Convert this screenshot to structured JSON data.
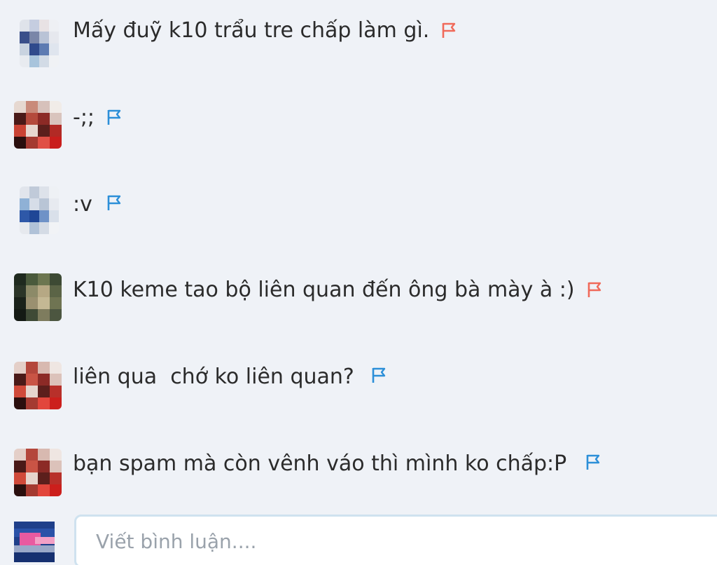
{
  "comments": [
    {
      "text": "Mấy đuỹ k10 trẩu tre chấp làm gì.",
      "flag": "red-flag-icon",
      "flag_color": "#f06a5a"
    },
    {
      "text": "-;;",
      "flag": "blue-flag-icon",
      "flag_color": "#2c8fd8"
    },
    {
      "text": ":v",
      "flag": "blue-flag-icon",
      "flag_color": "#2c8fd8"
    },
    {
      "text": "K10 keme tao bộ liên quan đến ông bà mày à :)",
      "flag": "red-flag-icon",
      "flag_color": "#f06a5a"
    },
    {
      "text": "liên qua  chớ ko liên quan?",
      "flag": "blue-flag-icon",
      "flag_color": "#2c8fd8"
    },
    {
      "text": "bạn spam mà còn vênh váo thì mình ko chấp:P",
      "flag": "blue-flag-icon",
      "flag_color": "#2c8fd8"
    }
  ],
  "composer": {
    "placeholder": "Viết bình luận...."
  },
  "colors": {
    "background": "#eff2f7",
    "input_border": "#cfe2ef"
  }
}
